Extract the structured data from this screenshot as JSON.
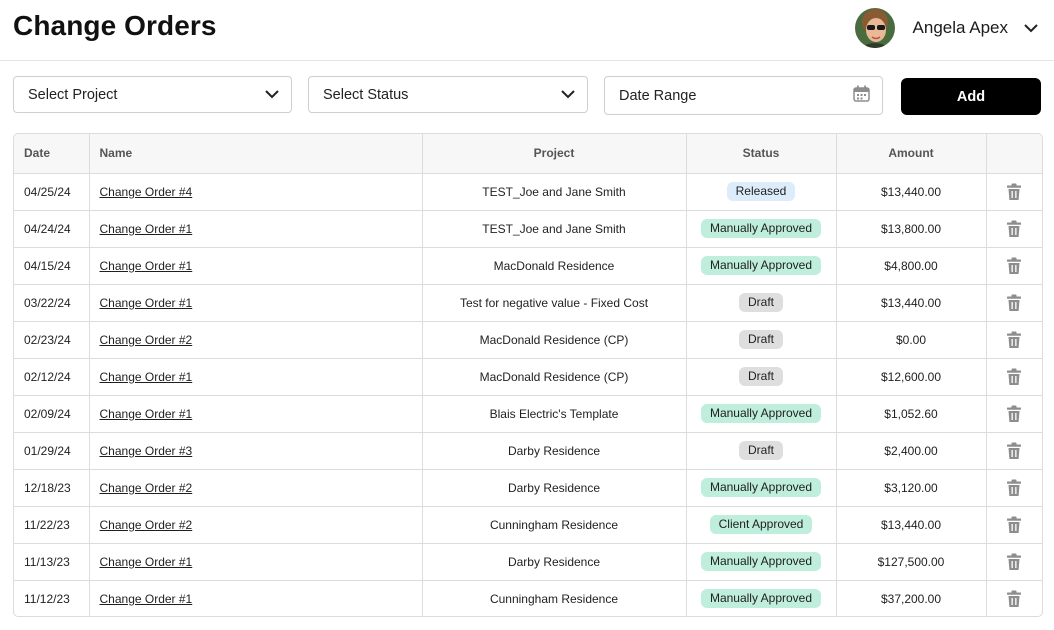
{
  "header": {
    "title": "Change Orders",
    "user_name": "Angela Apex"
  },
  "filters": {
    "project_label": "Select Project",
    "status_label": "Select Status",
    "date_label": "Date Range",
    "add_label": "Add"
  },
  "table": {
    "columns": [
      "Date",
      "Name",
      "Project",
      "Status",
      "Amount",
      ""
    ],
    "rows": [
      {
        "date": "04/25/24",
        "name": "Change Order #4",
        "project": "TEST_Joe and Jane Smith",
        "status": "Released",
        "amount": "$13,440.00"
      },
      {
        "date": "04/24/24",
        "name": "Change Order #1",
        "project": "TEST_Joe and Jane Smith",
        "status": "Manually Approved",
        "amount": "$13,800.00"
      },
      {
        "date": "04/15/24",
        "name": "Change Order #1",
        "project": "MacDonald Residence",
        "status": "Manually Approved",
        "amount": "$4,800.00"
      },
      {
        "date": "03/22/24",
        "name": "Change Order #1",
        "project": "Test for negative value - Fixed Cost",
        "status": "Draft",
        "amount": "$13,440.00"
      },
      {
        "date": "02/23/24",
        "name": "Change Order #2",
        "project": "MacDonald Residence (CP)",
        "status": "Draft",
        "amount": "$0.00"
      },
      {
        "date": "02/12/24",
        "name": "Change Order #1",
        "project": "MacDonald Residence (CP)",
        "status": "Draft",
        "amount": "$12,600.00"
      },
      {
        "date": "02/09/24",
        "name": "Change Order #1",
        "project": "Blais Electric's Template",
        "status": "Manually Approved",
        "amount": "$1,052.60"
      },
      {
        "date": "01/29/24",
        "name": "Change Order #3",
        "project": "Darby Residence",
        "status": "Draft",
        "amount": "$2,400.00"
      },
      {
        "date": "12/18/23",
        "name": "Change Order #2",
        "project": "Darby Residence",
        "status": "Manually Approved",
        "amount": "$3,120.00"
      },
      {
        "date": "11/22/23",
        "name": "Change Order #2",
        "project": "Cunningham Residence",
        "status": "Client Approved",
        "amount": "$13,440.00"
      },
      {
        "date": "11/13/23",
        "name": "Change Order #1",
        "project": "Darby Residence",
        "status": "Manually Approved",
        "amount": "$127,500.00"
      },
      {
        "date": "11/12/23",
        "name": "Change Order #1",
        "project": "Cunningham Residence",
        "status": "Manually Approved",
        "amount": "$37,200.00"
      }
    ]
  },
  "icons": {
    "chevron": "chevron-down-icon",
    "calendar": "calendar-icon",
    "trash": "trash-icon",
    "avatar": "avatar"
  },
  "colors": {
    "released": "#dcecfb",
    "approved": "#bfeedd",
    "draft": "#dedede",
    "add_button": "#000000"
  }
}
